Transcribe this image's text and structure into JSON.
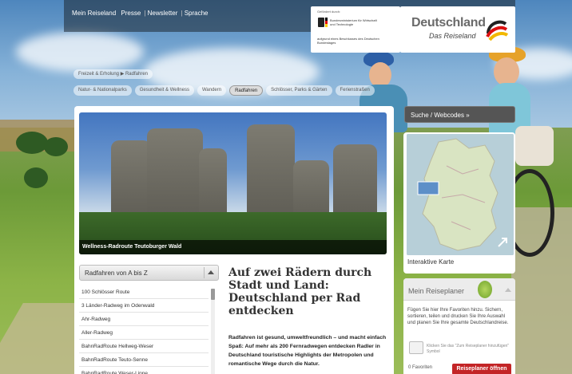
{
  "top_nav": {
    "items": [
      "Mein Reiseland",
      "Presse",
      "Newsletter",
      "Sprache"
    ]
  },
  "sponsor": {
    "small": "Gefördert durch:",
    "ministry": "Bundesministerium für Wirtschaft und Technologie",
    "footer": "aufgrund eines Beschlusses des Deutschen Bundestages"
  },
  "brand": {
    "title": "Deutschland",
    "subtitle": "Das Reiseland"
  },
  "breadcrumb": "Freizeit & Erholung ▶ Radfahren",
  "categories": [
    {
      "label": "Natur- & Nationalparks",
      "active": false
    },
    {
      "label": "Gesundheit & Wellness",
      "active": false
    },
    {
      "label": "Wandern",
      "active": false
    },
    {
      "label": "Radfahren",
      "active": true
    },
    {
      "label": "Schlösser, Parks & Gärten",
      "active": false
    },
    {
      "label": "Ferienstraßen",
      "active": false
    }
  ],
  "hero": {
    "caption": "Wellness-Radroute Teutoburger Wald"
  },
  "list": {
    "header": "Radfahren von A bis Z",
    "items": [
      "100 Schlösser Route",
      "3 Länder-Radweg im Odenwald",
      "Ahr-Radweg",
      "Aller-Radweg",
      "BahnRadRoute Hellweg-Weser",
      "BahnRadRoute Teuto-Senne",
      "BahnRadRoute Weser-Lippe"
    ]
  },
  "article": {
    "title": "Auf zwei Rädern durch Stadt und Land: Deutschland per Rad entdecken",
    "body": "Radfahren ist gesund, umweltfreundlich – und macht einfach Spaß: Auf mehr als 200 Fernradwegen entdecken Radler in Deutschland touristische Highlights der Metropolen und romantische Wege durch die Natur."
  },
  "sidebar": {
    "search_label": "Suche / Webcodes »",
    "map_label": "Interaktive Karte",
    "planner": {
      "title": "Mein Reiseplaner",
      "text": "Fügen Sie hier Ihre Favoriten hinzu. Sichern, sortieren, teilen und drucken Sie Ihre Auswahl und planen Sie Ihre gesamte Deutschlandreise.",
      "tip": "Klicken Sie das \"Zum Reiseplaner hinzufügen\" Symbol",
      "favorites": "0 Favoriten",
      "button": "Reiseplaner öffnen"
    }
  },
  "colors": {
    "accent_red": "#c32527",
    "nav_dark": "#555555"
  }
}
